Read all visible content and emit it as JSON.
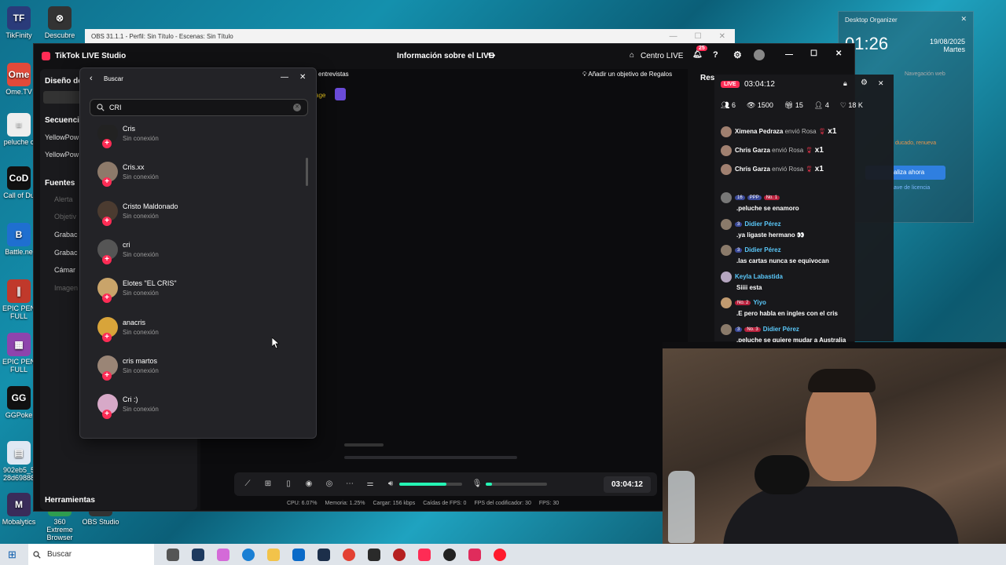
{
  "desktop_icons": [
    {
      "label": "TikFinity",
      "glyph": "TF",
      "color": "#2a3b7a"
    },
    {
      "label": "Descubre",
      "glyph": "⊗",
      "color": "#333"
    },
    {
      "label": "Ome.TV",
      "glyph": "Ome",
      "color": "#e24a3a"
    },
    {
      "label": "peluche c",
      "glyph": "≡",
      "color": "#eeeeee"
    },
    {
      "label": "Call of Du",
      "glyph": "CoD",
      "color": "#111"
    },
    {
      "label": "Battle.ne",
      "glyph": "B",
      "color": "#1f6fd0"
    },
    {
      "label": "EPIC PEN FULL",
      "glyph": "∥",
      "color": "#c0392b"
    },
    {
      "label": "EPIC PEN FULL",
      "glyph": "▦",
      "color": "#8e44ad"
    },
    {
      "label": "GGPoke",
      "glyph": "GG",
      "color": "#111"
    },
    {
      "label": "902eb5_5 28d69888",
      "glyph": "▤",
      "color": "#dfe8f3"
    },
    {
      "label": "Mobalytics",
      "glyph": "M",
      "color": "#3a2c5a"
    },
    {
      "label": "360 Extreme Browser",
      "glyph": "◎",
      "color": "#2e9d4f"
    },
    {
      "label": "OBS Studio",
      "glyph": "◉",
      "color": "#333"
    }
  ],
  "obs_bar": {
    "title": "OBS 31.1.1 - Perfil: Sin Título - Escenas: Sin Título"
  },
  "tiktok": {
    "app_title": "TikTok LIVE Studio",
    "center_title": "Información sobre el LIVE",
    "centro_live": "Centro LIVE",
    "notif_count": "25",
    "left_panel": {
      "design_title": "Diseño de",
      "sequences": "Secuencias",
      "seq_items": [
        "YellowPow",
        "YellowPow"
      ],
      "sources": "Fuentes",
      "source_items": [
        "Alerta",
        "Objetiv",
        "Grabac",
        "Grabac",
        "Cámar",
        "Imagen"
      ],
      "tools": "Herramientas"
    },
    "interviews": "entrevistas",
    "stage_label": "age",
    "gift_goal": "Añadir un objetivo de Regalos",
    "results_label": "Res",
    "timer": "03:04:12",
    "stats": [
      "CPU: 6.07%",
      "Memoria: 1.25%",
      "Cargar: 156 kbps",
      "Caídas de FPS: 0",
      "FPS del codificador: 30",
      "FPS: 30"
    ]
  },
  "search": {
    "title": "Buscar",
    "query": "CRI",
    "results": [
      {
        "name": "Cris",
        "status": "Sin conexión",
        "color": "#222"
      },
      {
        "name": "Cris.xx",
        "status": "Sin conexión",
        "color": "#8d7a6a"
      },
      {
        "name": "Cristo Maldonado",
        "status": "Sin conexión",
        "color": "#4b3b30"
      },
      {
        "name": "cri",
        "status": "Sin conexión",
        "color": "#555"
      },
      {
        "name": "Elotes \"EL CRIS\"",
        "status": "Sin conexión",
        "color": "#c9a46a"
      },
      {
        "name": "anacris",
        "status": "Sin conexión",
        "color": "#d8a43a"
      },
      {
        "name": "cris martos",
        "status": "Sin conexión",
        "color": "#9a8576"
      },
      {
        "name": "Cri :)",
        "status": "Sin conexión",
        "color": "#d7a9c8"
      }
    ]
  },
  "live_panel": {
    "live_badge": "LIVE",
    "timer": "03:04:12",
    "viewers": "6",
    "views": "1500",
    "gifts": "15",
    "followers": "4",
    "likes": "18 K",
    "gift_events": [
      {
        "user": "Ximena Pedraza",
        "action": "envió Rosa",
        "count": "x1"
      },
      {
        "user": "Chris Garza",
        "action": "envió Rosa",
        "count": "x1"
      },
      {
        "user": "Chris Garza",
        "action": "envió Rosa",
        "count": "x1"
      }
    ],
    "chat": [
      {
        "name": "",
        "badges": [
          "16",
          "PPP",
          "No. 1"
        ],
        "msg": ".peluche se enamoro"
      },
      {
        "name": "Didier Pérez",
        "badges": [
          "3"
        ],
        "msg": ".ya ligaste hermano 👀"
      },
      {
        "name": "Didier Pérez",
        "badges": [
          "3"
        ],
        "msg": ".las cartas nunca se equivocan"
      },
      {
        "name": "Keyla Labastida",
        "badges": [],
        "msg": "Siiii esta"
      },
      {
        "name": "Yiyo",
        "badges": [
          "No. 2"
        ],
        "msg": ".E pero habla en ingles con el cris"
      },
      {
        "name": "Didier Pérez",
        "badges": [
          "3",
          "No. 3"
        ],
        "msg": ".peluche se quiere mudar a Australia"
      }
    ]
  },
  "desktop_organizer": {
    "title": "Desktop Organizer",
    "time": "01:26",
    "date": "19/08/2025",
    "day": "Martes",
    "btn": "aliza ahora",
    "link": "ave de licencia",
    "notice": "ducado, renueva",
    "nav": "Navegación web"
  },
  "taskbar": {
    "search": "Buscar"
  }
}
